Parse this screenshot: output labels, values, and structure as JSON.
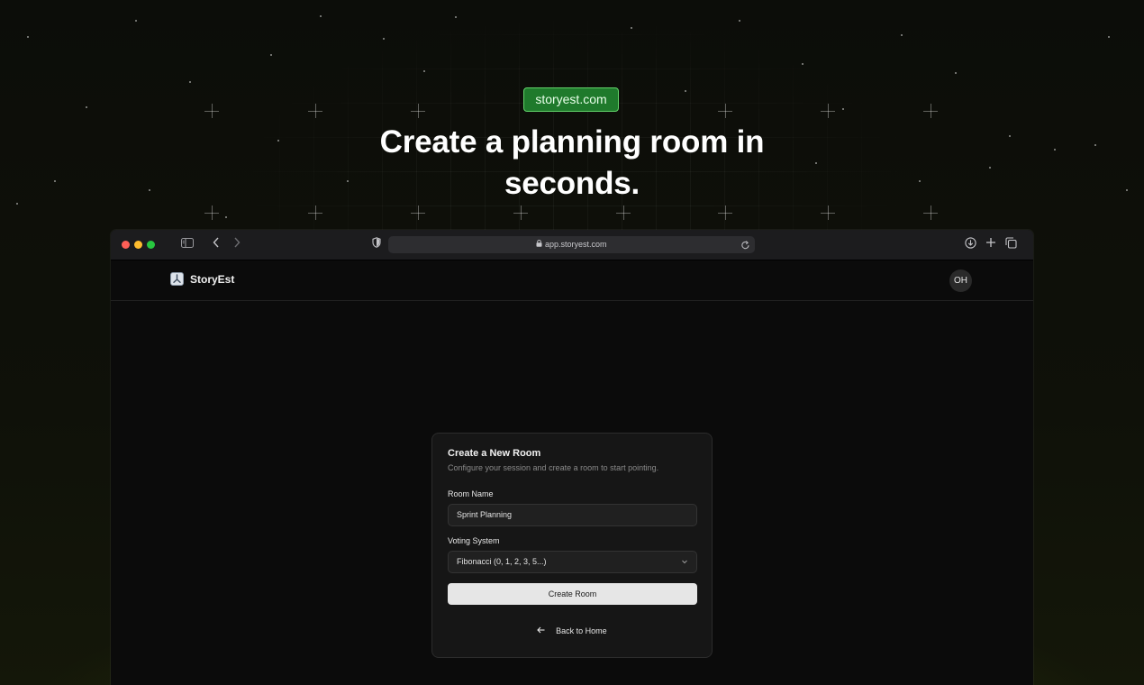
{
  "hero": {
    "badge": "storyest.com",
    "title_line1": "Create a planning room in",
    "title_line2": "seconds."
  },
  "browser": {
    "url": "app.storyest.com",
    "icons": [
      "sidebar-icon",
      "back-icon",
      "forward-icon",
      "shield-icon",
      "lock-icon",
      "reload-icon",
      "download-icon",
      "new-tab-icon",
      "tabs-overview-icon"
    ]
  },
  "app": {
    "brand": "StoryEst",
    "avatar_initials": "OH"
  },
  "form": {
    "title": "Create a New Room",
    "subtitle": "Configure your session and create a room to start pointing.",
    "room_name_label": "Room Name",
    "room_name_value": "Sprint Planning",
    "voting_system_label": "Voting System",
    "voting_system_value": "Fibonacci (0, 1, 2, 3, 5...)",
    "create_button": "Create Room",
    "back_link": "Back to Home"
  },
  "colors": {
    "badge_bg": "#1f7a2c",
    "badge_border": "#62d36a",
    "page_bg": "#0e0f0a",
    "card_bg": "#161616",
    "button_bg": "#e6e6e6"
  }
}
